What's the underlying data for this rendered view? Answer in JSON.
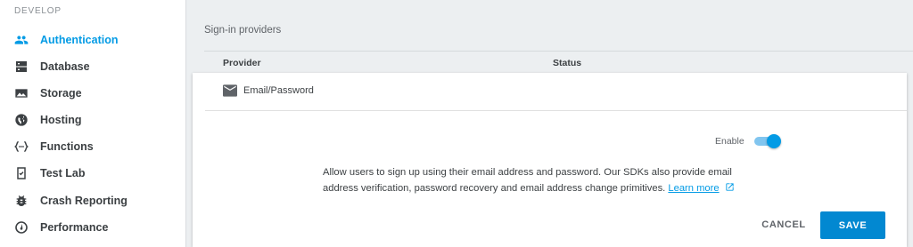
{
  "sidebar": {
    "section_label": "DEVELOP",
    "items": [
      {
        "label": "Authentication",
        "icon": "people-icon",
        "active": true
      },
      {
        "label": "Database",
        "icon": "database-icon",
        "active": false
      },
      {
        "label": "Storage",
        "icon": "image-icon",
        "active": false
      },
      {
        "label": "Hosting",
        "icon": "globe-icon",
        "active": false
      },
      {
        "label": "Functions",
        "icon": "functions-icon",
        "active": false
      },
      {
        "label": "Test Lab",
        "icon": "test-lab-icon",
        "active": false
      },
      {
        "label": "Crash Reporting",
        "icon": "bug-icon",
        "active": false
      },
      {
        "label": "Performance",
        "icon": "speedometer-icon",
        "active": false
      }
    ]
  },
  "main": {
    "providers_title": "Sign-in providers",
    "table": {
      "columns": [
        "Provider",
        "Status"
      ]
    },
    "provider": {
      "name": "Email/Password",
      "icon": "email-icon"
    },
    "enable_label": "Enable",
    "enabled": true,
    "description": "Allow users to sign up using their email address and password. Our SDKs also provide email address verification, password recovery and email address change primitives.",
    "learn_more": "Learn more",
    "cancel_label": "CANCEL",
    "save_label": "SAVE"
  },
  "colors": {
    "accent": "#039be5",
    "save_button": "#0288d1",
    "background": "#eceff1"
  }
}
